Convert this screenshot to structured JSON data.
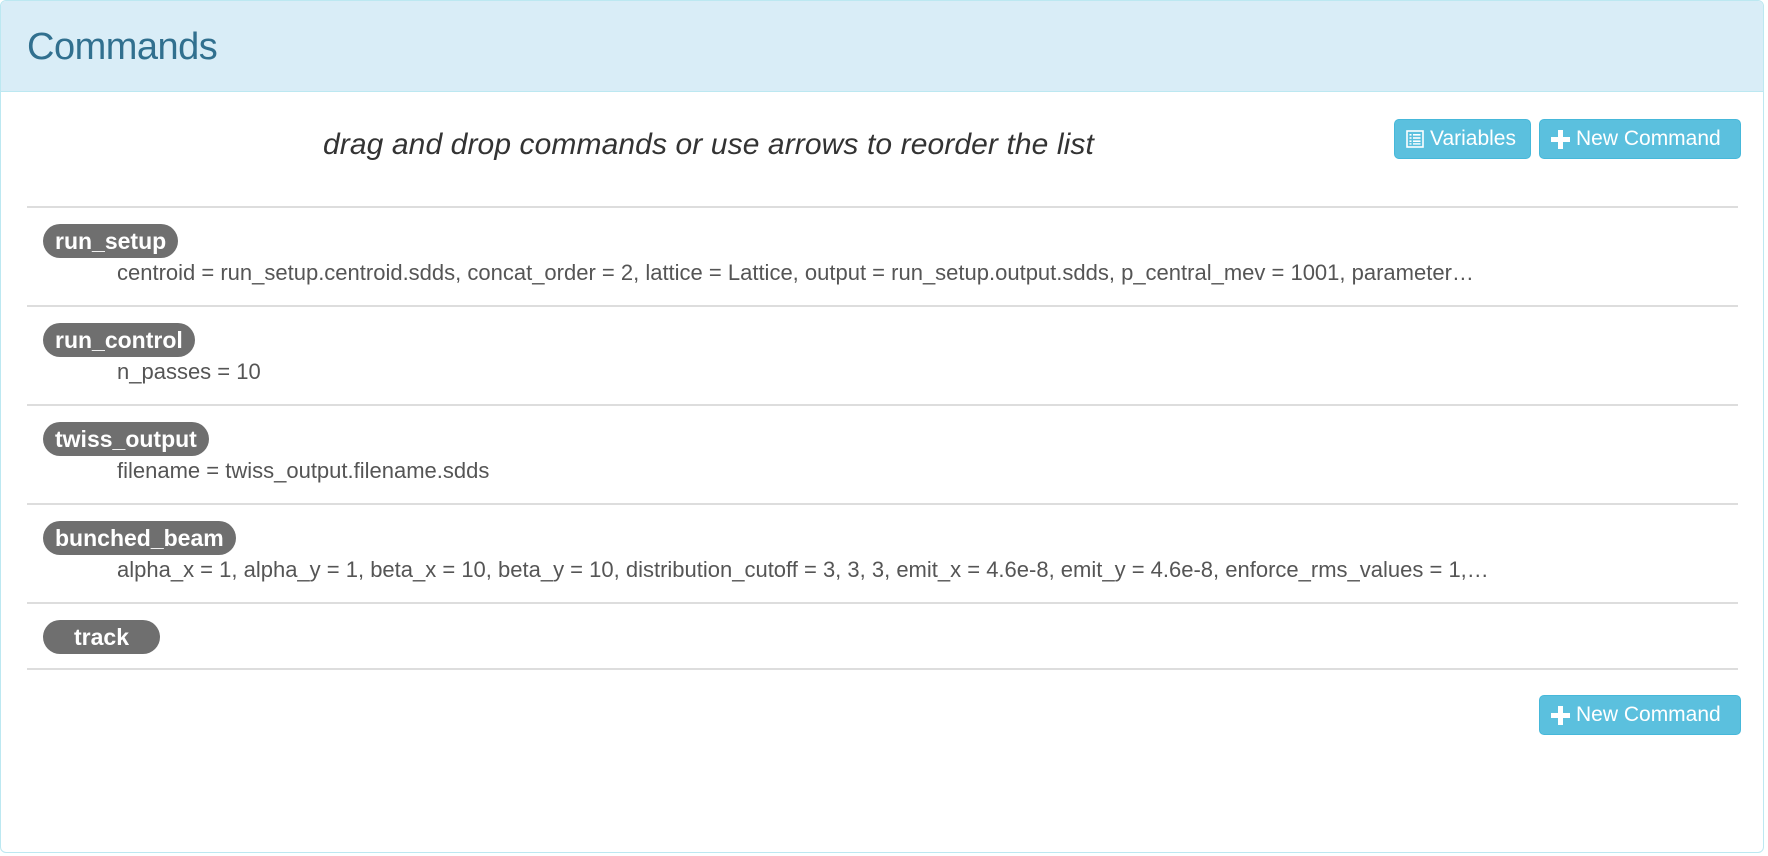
{
  "panel": {
    "title": "Commands"
  },
  "toolbar": {
    "hint": "drag and drop commands or use arrows to reorder the list",
    "variables_label": "Variables",
    "new_command_label": "New Command"
  },
  "commands": [
    {
      "name": "run_setup",
      "params": "centroid = run_setup.centroid.sdds, concat_order = 2, lattice = Lattice, output = run_setup.output.sdds, p_central_mev = 1001, parameter…"
    },
    {
      "name": "run_control",
      "params": "n_passes = 10"
    },
    {
      "name": "twiss_output",
      "params": "filename = twiss_output.filename.sdds"
    },
    {
      "name": "bunched_beam",
      "params": "alpha_x = 1, alpha_y = 1, beta_x = 10, beta_y = 10, distribution_cutoff = 3, 3, 3, emit_x = 4.6e-8, emit_y = 4.6e-8, enforce_rms_values = 1,…"
    },
    {
      "name": "track",
      "params": ""
    }
  ],
  "footer": {
    "new_command_label": "New Command"
  },
  "icons": {
    "variables": "list-icon",
    "new_command": "plus-icon"
  },
  "colors": {
    "heading_bg": "#d9edf7",
    "heading_text": "#31708f",
    "button_bg": "#5bc0de",
    "badge_bg": "#6f6f6f"
  }
}
